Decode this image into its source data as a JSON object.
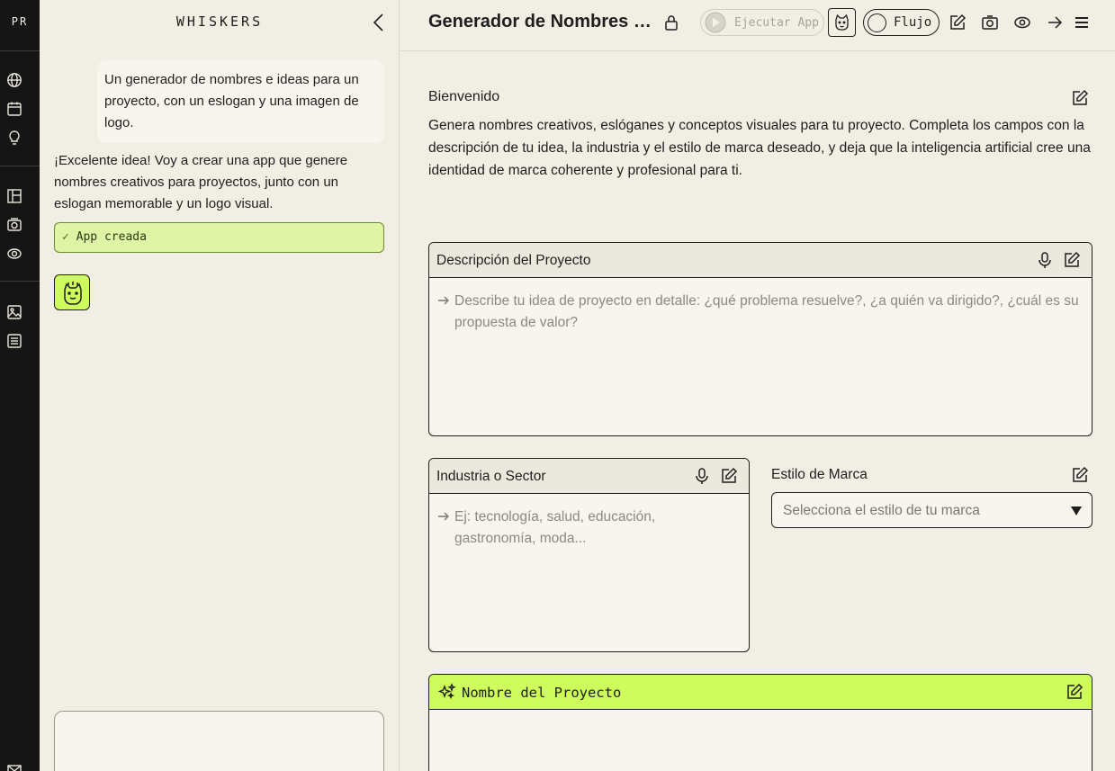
{
  "rail": {
    "brand": "PR",
    "icons": [
      "globe-icon",
      "calendar-icon",
      "lightbulb-icon",
      "layout-icon",
      "camera-icon",
      "eye-icon",
      "image-icon",
      "list-icon",
      "mail-icon"
    ]
  },
  "chat": {
    "title": "WHISKERS",
    "user_message": "Un generador de nombres e ideas para un proyecto, con un eslogan y una imagen de logo.",
    "bot_message": "¡Excelente idea! Voy a crear una app que genere nombres creativos para proyectos, junto con un eslogan memorable y un logo visual.",
    "status": "App creada",
    "input_value": ""
  },
  "header": {
    "title": "Generador de Nombres y Eslóganes",
    "run_label": "Ejecutar App",
    "flow_label": "Flujo"
  },
  "main": {
    "welcome_title": "Bienvenido",
    "welcome_text": "Genera nombres creativos, eslóganes y conceptos visuales para tu proyecto. Completa los campos con la descripción de tu idea, la industria y el estilo de marca deseado, y deja que la inteligencia artificial cree una identidad de marca coherente y profesional para ti.",
    "description": {
      "label": "Descripción del Proyecto",
      "placeholder": "Describe tu idea de proyecto en detalle: ¿qué problema resuelve?, ¿a quién va dirigido?, ¿cuál es su propuesta de valor?"
    },
    "industry": {
      "label": "Industria o Sector",
      "placeholder": "Ej: tecnología, salud, educación, gastronomía, moda..."
    },
    "brand_style": {
      "label": "Estilo de Marca",
      "placeholder": "Selecciona el estilo de tu marca"
    },
    "project_name": {
      "label": "Nombre del Proyecto"
    }
  },
  "colors": {
    "accent": "#cdfc5c",
    "rail_bg": "#151515",
    "page_bg": "#f1eee3",
    "success_bg": "#dff5a5"
  }
}
